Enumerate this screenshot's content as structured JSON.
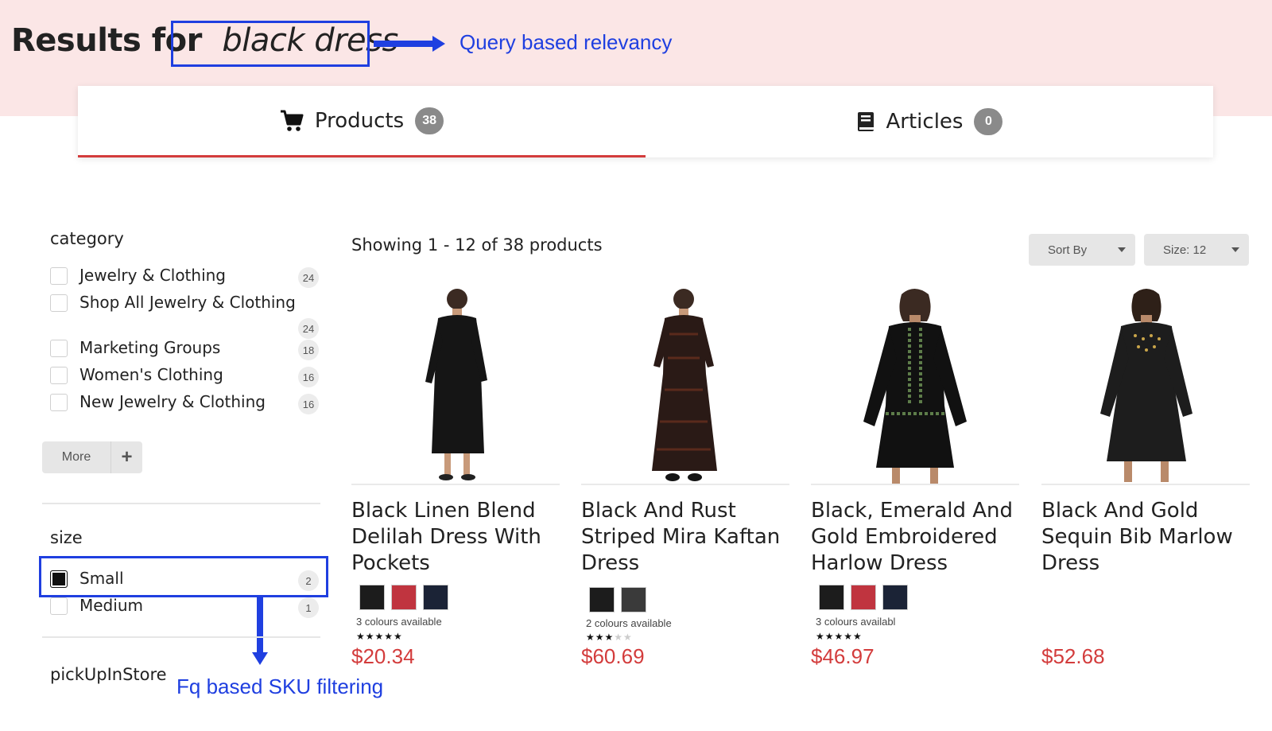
{
  "header": {
    "title_prefix": "Results for",
    "query": "black dress",
    "annotation_query": "Query based relevancy"
  },
  "tabs": [
    {
      "label": "Products",
      "count": "38",
      "icon": "cart-icon"
    },
    {
      "label": "Articles",
      "count": "0",
      "icon": "book-icon"
    }
  ],
  "facets": {
    "category": {
      "title": "category",
      "items": [
        {
          "label": "Jewelry & Clothing",
          "count": "24"
        },
        {
          "label": "Shop All Jewelry & Clothing",
          "count": "24"
        },
        {
          "label": "Marketing Groups",
          "count": "18"
        },
        {
          "label": "Women's Clothing",
          "count": "16"
        },
        {
          "label": "New Jewelry & Clothing",
          "count": "16"
        }
      ],
      "more_label": "More",
      "more_icon": "plus-icon"
    },
    "size": {
      "title": "size",
      "items": [
        {
          "label": "Small",
          "count": "2",
          "checked": true
        },
        {
          "label": "Medium",
          "count": "1",
          "checked": false
        }
      ]
    },
    "pickup": {
      "title": "pickUpInStore"
    },
    "annotation_fq": "Fq based SKU filtering"
  },
  "results": {
    "showing": "Showing 1 - 12 of 38 products",
    "sort_label": "Sort By",
    "size_label": "Size: 12",
    "products": [
      {
        "name": "Black Linen Blend Delilah Dress With Pockets",
        "swatches": [
          "#1c1c1c",
          "#c0343f",
          "#1b2336"
        ],
        "colours": "3 colours available",
        "rating": 4.5,
        "price": "$20.34"
      },
      {
        "name": "Black And Rust Striped Mira Kaftan Dress",
        "swatches": [
          "#1c1c1c",
          "#3a3a3a"
        ],
        "colours": "2 colours available",
        "rating": 3,
        "price": "$60.69"
      },
      {
        "name": "Black, Emerald And Gold Embroidered Harlow Dress",
        "swatches": [
          "#1c1c1c",
          "#c0343f",
          "#1b2336"
        ],
        "colours": "3 colours availabl",
        "rating": 4.5,
        "price": "$46.97"
      },
      {
        "name": "Black And Gold Sequin Bib Marlow Dress",
        "swatches": [],
        "colours": "",
        "rating": null,
        "price": "$52.68"
      }
    ]
  },
  "colors": {
    "accent_red": "#d33c3c",
    "annotation_blue": "#1f3fe0",
    "header_band": "#fbe6e6"
  }
}
